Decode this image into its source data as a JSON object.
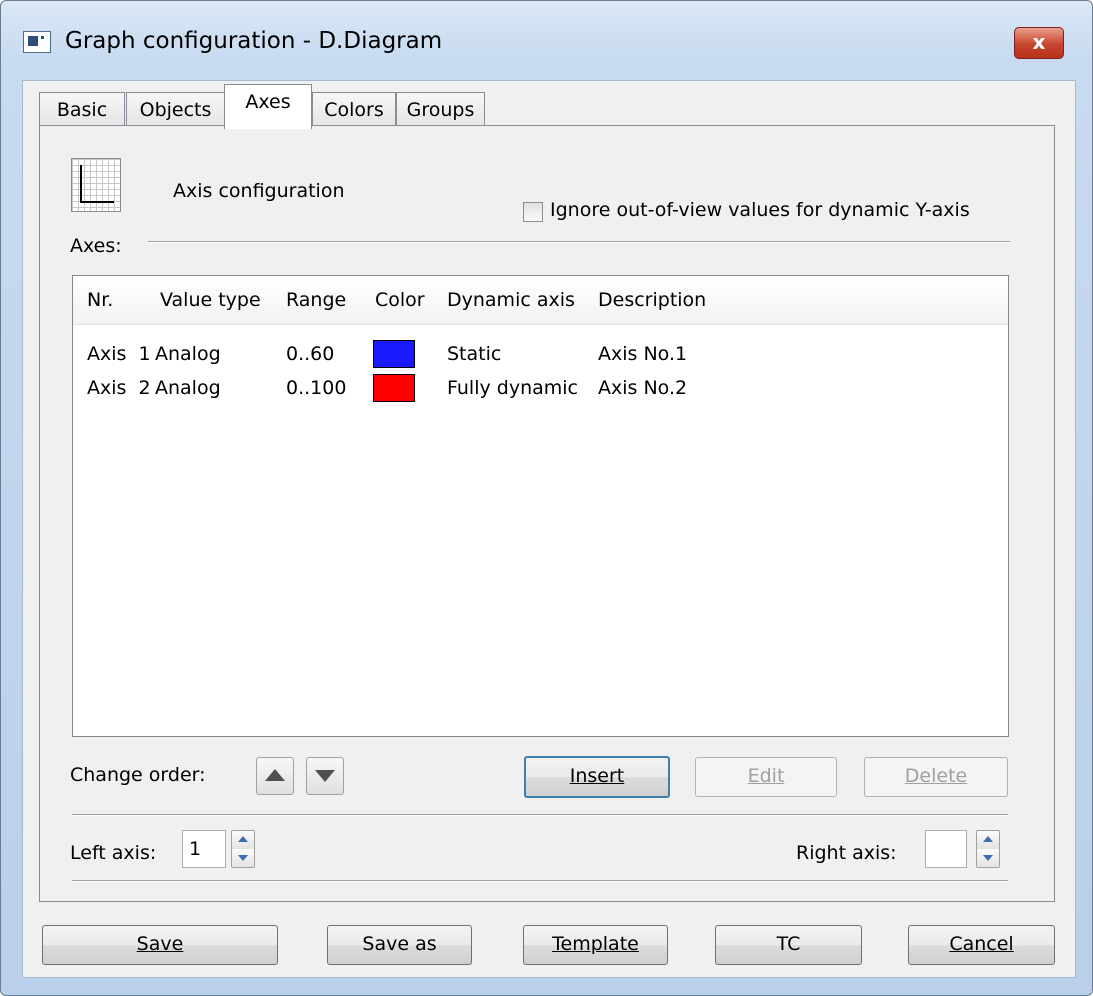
{
  "window": {
    "title": "Graph configuration -  D.Diagram",
    "close_label": "x"
  },
  "tabs": [
    {
      "label": "Basic"
    },
    {
      "label": "Objects"
    },
    {
      "label": "Axes",
      "active": true
    },
    {
      "label": "Colors"
    },
    {
      "label": "Groups"
    }
  ],
  "axes_page": {
    "heading": "Axis configuration",
    "ignore_checkbox_label": "Ignore out-of-view values for dynamic Y-axis",
    "ignore_checkbox_checked": false,
    "axes_label": "Axes:",
    "columns": [
      "Nr.",
      "Value type",
      "Range",
      "Color",
      "Dynamic axis",
      "Description"
    ],
    "rows": [
      {
        "nr": "Axis  1",
        "value_type": "Analog",
        "range": "0..60",
        "color": "#1a1aff",
        "dynamic": "Static",
        "description": "Axis No.1"
      },
      {
        "nr": "Axis  2",
        "value_type": "Analog",
        "range": "0..100",
        "color": "#ff0000",
        "dynamic": "Fully dynamic",
        "description": "Axis No.2"
      }
    ],
    "change_order_label": "Change order:",
    "insert_label": "Insert",
    "edit_label": "Edit",
    "delete_label": "Delete",
    "left_axis_label": "Left axis:",
    "left_axis_value": "1",
    "right_axis_label": "Right axis:",
    "right_axis_value": ""
  },
  "footer": {
    "save_label": "Save",
    "save_as_label": "Save as",
    "template_label": "Template",
    "tc_label": "TC",
    "cancel_label": "Cancel"
  }
}
